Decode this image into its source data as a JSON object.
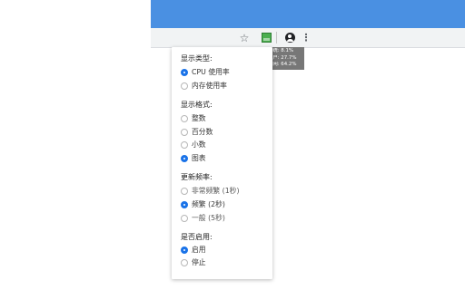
{
  "browser": {
    "toolbar_icons": {
      "bookmark": "star-icon",
      "extension": "chart-extension-icon",
      "profile": "profile-icon",
      "menu": "kebab-menu-icon"
    },
    "colors": {
      "titlebar": "#4a90e2",
      "accent": "#1a73e8",
      "extension_green": "#4caf50"
    }
  },
  "tooltip": {
    "lines": [
      "系统: 8.1%",
      "用户: 27.7%",
      "空闲: 64.2%"
    ]
  },
  "popup": {
    "sections": [
      {
        "title": "显示类型:",
        "options": [
          {
            "label": "CPU 使用率",
            "checked": true
          },
          {
            "label": "内存使用率",
            "checked": false
          }
        ]
      },
      {
        "title": "显示格式:",
        "options": [
          {
            "label": "整数",
            "checked": false
          },
          {
            "label": "百分数",
            "checked": false
          },
          {
            "label": "小数",
            "checked": false
          },
          {
            "label": "图表",
            "checked": true
          }
        ]
      },
      {
        "title": "更新频率:",
        "options": [
          {
            "label": "非常频繁 (1秒)",
            "checked": false
          },
          {
            "label": "频繁 (2秒)",
            "checked": true
          },
          {
            "label": "一般 (5秒)",
            "checked": false
          }
        ]
      },
      {
        "title": "是否启用:",
        "options": [
          {
            "label": "启用",
            "checked": true
          },
          {
            "label": "停止",
            "checked": false
          }
        ]
      }
    ]
  }
}
